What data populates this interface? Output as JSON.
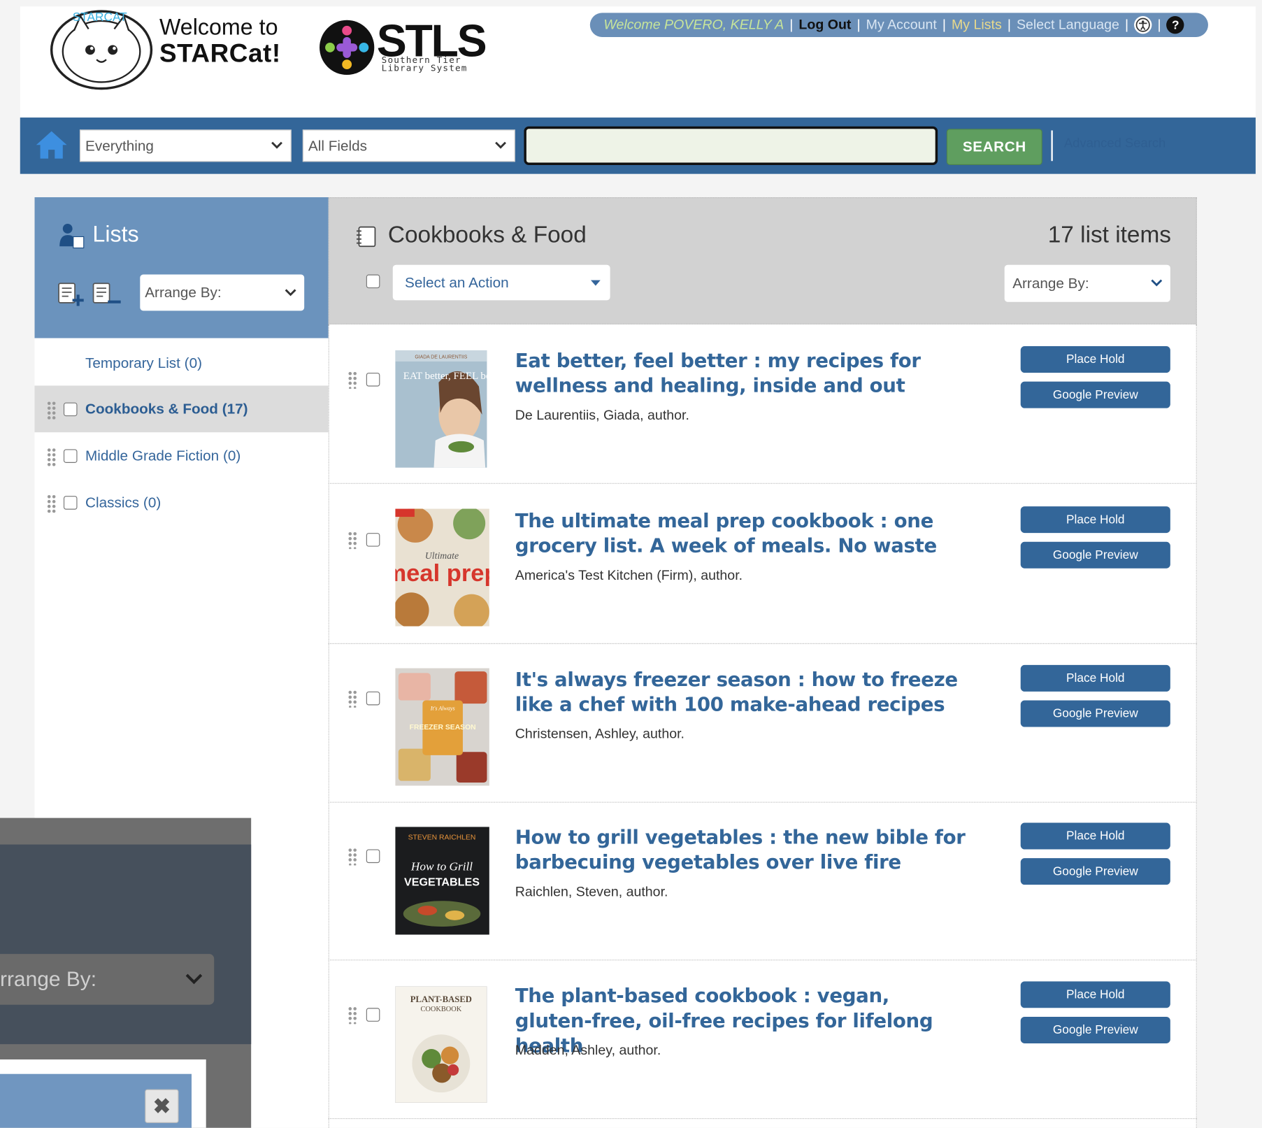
{
  "header": {
    "welcome_line1": "Welcome to",
    "welcome_line2": "STARCat!",
    "starcat_badge": "STARCAT",
    "stls_word": "STLS",
    "stls_sub1": "Southern Tier",
    "stls_sub2": "Library System"
  },
  "account_bar": {
    "welcome": "Welcome POVERO, KELLY A",
    "logout": "Log Out",
    "my_account": "My Account",
    "my_lists": "My Lists",
    "select_language": "Select Language",
    "accessibility_icon": "accessibility-icon",
    "help_icon": "help-icon",
    "help_glyph": "?"
  },
  "search": {
    "scope_value": "Everything",
    "field_value": "All Fields",
    "query_value": "",
    "button_label": "SEARCH",
    "advanced_label": "Advanced Search"
  },
  "lists_panel": {
    "title": "Lists",
    "arrange_label": "Arrange By:",
    "items": [
      {
        "label": "Temporary List (0)"
      },
      {
        "label": "Cookbooks & Food (17)"
      },
      {
        "label": "Middle Grade Fiction (0)"
      },
      {
        "label": "Classics (0)"
      }
    ]
  },
  "main": {
    "list_title": "Cookbooks & Food",
    "item_count": "17 list items",
    "action_placeholder": "Select an Action",
    "arrange_label": "Arrange By:",
    "place_hold_label": "Place Hold",
    "google_preview_label": "Google Preview",
    "items": [
      {
        "title": "Eat better, feel better : my recipes for wellness and healing, inside and out",
        "author": "De Laurentiis, Giada, author.",
        "cover_text": "EAT better, FEEL better",
        "cover_top": "GIADA DE LAURENTIIS"
      },
      {
        "title": "The ultimate meal prep cookbook : one grocery list. A week of meals. No waste",
        "author": "America's Test Kitchen (Firm), author.",
        "cover_text": "meal prep",
        "cover_top": "Ultimate"
      },
      {
        "title": "It's always freezer season : how to freeze like a chef with 100 make-ahead recipes",
        "author": "Christensen, Ashley, author.",
        "cover_text": "FREEZER SEASON",
        "cover_top": "It's Always"
      },
      {
        "title": "How to grill vegetables : the new bible for barbecuing vegetables over live fire",
        "author": "Raichlen, Steven, author.",
        "cover_text": "VEGETABLES",
        "cover_top": "STEVEN RAICHLEN",
        "cover_script": "How to Grill"
      },
      {
        "title": "The plant-based cookbook : vegan, gluten-free, oil-free recipes for lifelong health",
        "author": "Madden, Ashley, author.",
        "cover_text": "PLANT-BASED",
        "cover_top": "COOKBOOK"
      }
    ]
  },
  "overlay": {
    "arrange_label": "rrange By:",
    "close_glyph": "✖"
  },
  "colors": {
    "nav_blue": "#336699",
    "panel_blue": "#6b93bd",
    "search_green": "#5f9e5f",
    "link_blue": "#34659b"
  }
}
